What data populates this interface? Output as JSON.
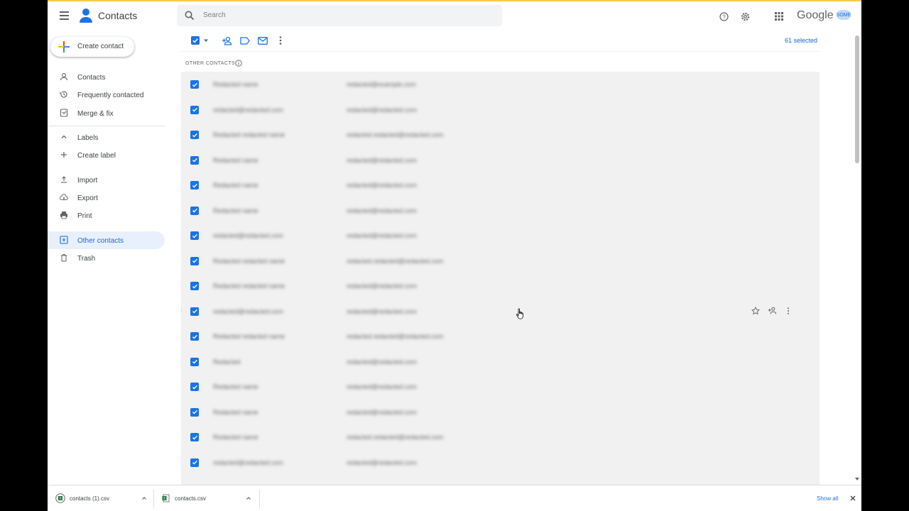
{
  "header": {
    "app_title": "Contacts",
    "search_placeholder": "Search",
    "google_wordmark": "Google",
    "avatar_text": "SOME"
  },
  "sidebar": {
    "create_label": "Create contact",
    "items": [
      {
        "label": "Contacts",
        "icon": "person-icon"
      },
      {
        "label": "Frequently contacted",
        "icon": "history-icon"
      },
      {
        "label": "Merge & fix",
        "icon": "merge-icon"
      },
      {
        "label": "Labels",
        "icon": "chevron-up-icon"
      },
      {
        "label": "Create label",
        "icon": "plus-icon"
      },
      {
        "label": "Import",
        "icon": "upload-icon"
      },
      {
        "label": "Export",
        "icon": "cloud-download-icon"
      },
      {
        "label": "Print",
        "icon": "print-icon"
      },
      {
        "label": "Other contacts",
        "icon": "other-contacts-icon",
        "active": true
      },
      {
        "label": "Trash",
        "icon": "trash-icon"
      }
    ]
  },
  "toolbar": {
    "selected_text": "61 selected"
  },
  "list": {
    "section_title": "OTHER CONTACTS",
    "rows": [
      {
        "name": "Redacted name",
        "email": "redacted@example.com"
      },
      {
        "name": "redacted@redacted.com",
        "email": "redacted@redacted.com"
      },
      {
        "name": "Redacted redacted name",
        "email": "redacted.redacted@redacted.com"
      },
      {
        "name": "Redacted name",
        "email": "redacted@redacted.com"
      },
      {
        "name": "Redacted name",
        "email": "redacted@redacted.com"
      },
      {
        "name": "Redacted name",
        "email": "redacted@redacted.com"
      },
      {
        "name": "redacted@redacted.com",
        "email": "redacted@redacted.com"
      },
      {
        "name": "Redacted redacted name",
        "email": "redacted.redacted@redacted.com"
      },
      {
        "name": "Redacted redacted name",
        "email": "redacted@redacted.com"
      },
      {
        "name": "redacted@redacted.com",
        "email": "redacted@redacted.com"
      },
      {
        "name": "Redacted redacted name",
        "email": "redacted.redacted@redacted.com"
      },
      {
        "name": "Redacted",
        "email": "redacted@redacted.com"
      },
      {
        "name": "Redacted name",
        "email": "redacted@redacted.com"
      },
      {
        "name": "Redacted name",
        "email": "redacted@redacted.com"
      },
      {
        "name": "Redacted name",
        "email": "redacted.redacted@redacted.com"
      },
      {
        "name": "redacted@redacted.com",
        "email": "redacted@redacted.com"
      }
    ]
  },
  "downloads": {
    "items": [
      {
        "name": "contacts (1).csv"
      },
      {
        "name": "contacts.csv"
      }
    ],
    "show_all_label": "Show all"
  }
}
